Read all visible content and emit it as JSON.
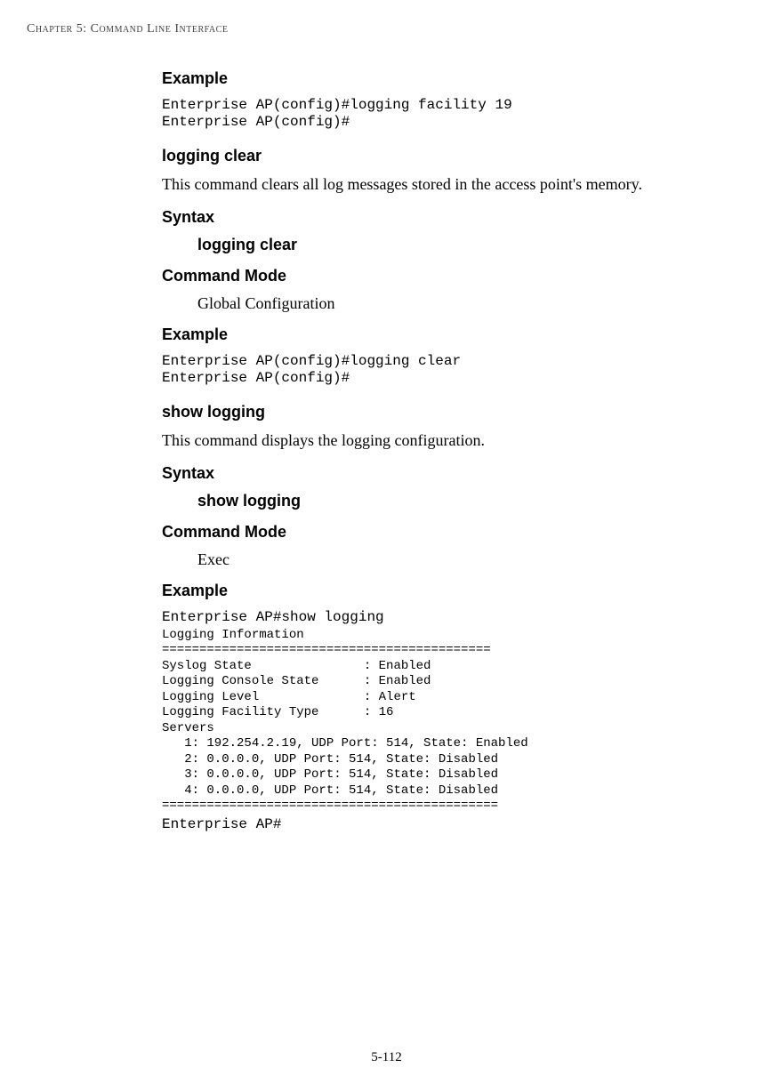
{
  "header": {
    "running_head": "Chapter 5: Command Line Interface"
  },
  "sections": {
    "example1_heading": "Example",
    "example1_code": "Enterprise AP(config)#logging facility 19\nEnterprise AP(config)#",
    "logging_clear": {
      "title": "logging clear",
      "desc": "This command clears all log messages stored in the access point's memory.",
      "syntax_heading": "Syntax",
      "syntax_value": "logging clear",
      "mode_heading": "Command Mode",
      "mode_value": "Global Configuration",
      "example_heading": "Example",
      "example_code": "Enterprise AP(config)#logging clear\nEnterprise AP(config)#"
    },
    "show_logging": {
      "title": "show logging",
      "desc": "This command displays the logging configuration.",
      "syntax_heading": "Syntax",
      "syntax_value": "show logging",
      "mode_heading": "Command Mode",
      "mode_value": "Exec",
      "example_heading": "Example",
      "example_code_line1": "Enterprise AP#show logging",
      "example_code_body": "Logging Information\n============================================\nSyslog State               : Enabled\nLogging Console State      : Enabled\nLogging Level              : Alert\nLogging Facility Type      : 16\nServers\n   1: 192.254.2.19, UDP Port: 514, State: Enabled\n   2: 0.0.0.0, UDP Port: 514, State: Disabled\n   3: 0.0.0.0, UDP Port: 514, State: Disabled\n   4: 0.0.0.0, UDP Port: 514, State: Disabled\n=============================================",
      "example_code_line3": "Enterprise AP#"
    }
  },
  "footer": {
    "page_number": "5-112"
  }
}
